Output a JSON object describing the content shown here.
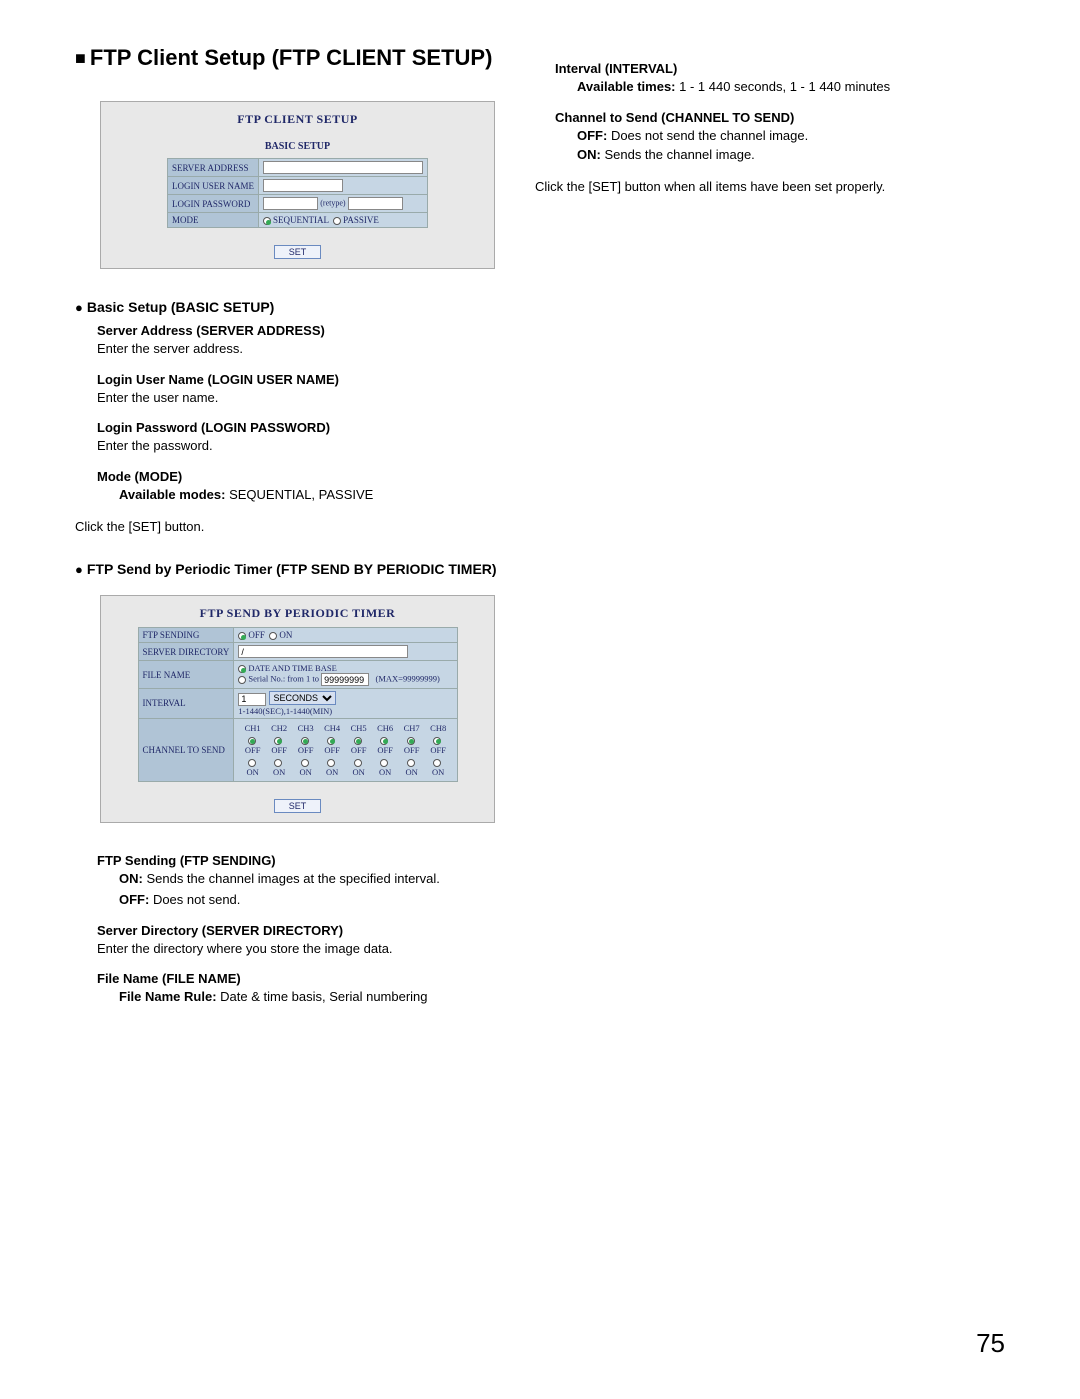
{
  "heading": {
    "title": "FTP Client Setup (FTP CLIENT SETUP)"
  },
  "panel1": {
    "title": "FTP CLIENT SETUP",
    "subtitle": "BASIC SETUP",
    "rows": {
      "server_address": "SERVER ADDRESS",
      "login_user_name": "LOGIN USER NAME",
      "login_password": "LOGIN PASSWORD",
      "retype": "(retype)",
      "mode": "MODE",
      "mode_seq": "SEQUENTIAL",
      "mode_pas": "PASSIVE"
    },
    "set": "SET"
  },
  "basic_setup": {
    "heading": "Basic Setup (BASIC SETUP)",
    "server_address_h": "Server Address (SERVER ADDRESS)",
    "server_address_t": "Enter the server address.",
    "login_user_h": "Login User Name (LOGIN USER NAME)",
    "login_user_t": "Enter the user name.",
    "login_pass_h": "Login Password (LOGIN PASSWORD)",
    "login_pass_t": "Enter the password.",
    "mode_h": "Mode (MODE)",
    "mode_label": "Available modes:",
    "mode_vals": " SEQUENTIAL, PASSIVE",
    "click_set": "Click the [SET] button."
  },
  "periodic": {
    "heading": "FTP Send by Periodic Timer (FTP SEND BY PERIODIC TIMER)"
  },
  "panel2": {
    "title": "FTP SEND BY PERIODIC TIMER",
    "rows": {
      "ftp_sending": "FTP SENDING",
      "off": "OFF",
      "on": "ON",
      "server_dir": "SERVER DIRECTORY",
      "server_dir_val": "/",
      "file_name": "FILE NAME",
      "fn_opt1": "DATE AND TIME BASE",
      "fn_opt2_a": "Serial No.: from 1 to",
      "fn_opt2_val": "99999999",
      "fn_opt2_b": "(MAX=99999999)",
      "interval": "INTERVAL",
      "interval_val": "1",
      "interval_unit": "SECONDS",
      "interval_note": "1-1440(SEC),1-1440(MIN)",
      "channel": "CHANNEL TO SEND",
      "ch": [
        "CH1",
        "CH2",
        "CH3",
        "CH4",
        "CH5",
        "CH6",
        "CH7",
        "CH8"
      ]
    },
    "set": "SET"
  },
  "periodic_desc": {
    "ftp_sending_h": "FTP Sending (FTP SENDING)",
    "on_label": "ON:",
    "on_text": " Sends the channel images at the specified interval.",
    "off_label": "OFF:",
    "off_text": " Does not send.",
    "server_dir_h": "Server Directory (SERVER DIRECTORY)",
    "server_dir_t": "Enter the directory where you store the image data.",
    "file_name_h": "File Name (FILE NAME)",
    "fn_rule_label": "File Name Rule:",
    "fn_rule_text": " Date & time basis, Serial numbering"
  },
  "right_col": {
    "interval_h": "Interval (INTERVAL)",
    "avail_label": "Available times:",
    "avail_text": " 1 - 1 440 seconds, 1 - 1 440 minutes",
    "channel_h": "Channel to Send (CHANNEL TO SEND)",
    "ch_off_label": "OFF:",
    "ch_off_text": " Does not send the channel image.",
    "ch_on_label": "ON:",
    "ch_on_text": " Sends the channel image.",
    "final": "Click the [SET] button when all items have been set properly."
  },
  "page_number": "75"
}
